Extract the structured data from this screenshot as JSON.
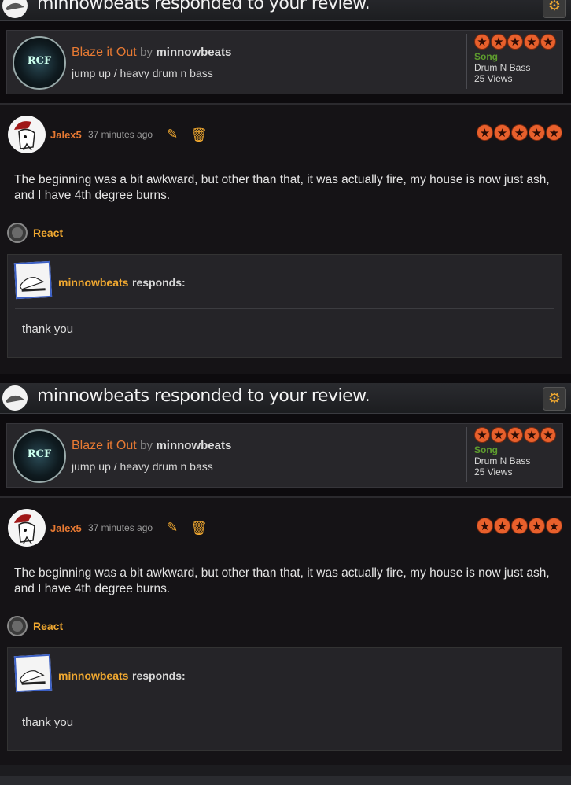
{
  "notifications": [
    {
      "header": {
        "title": "minnowbeats responded to your review.",
        "settings_icon": "gear-icon"
      },
      "song": {
        "art_text": "RCF",
        "title": "Blaze it Out",
        "by": "by",
        "author": "minnowbeats",
        "description": "jump up / heavy drum n bass",
        "rating_stars": 5,
        "type": "Song",
        "genre": "Drum N Bass",
        "views": "25 Views"
      },
      "review": {
        "user": "Jalex5",
        "time": "37 minutes ago",
        "rating_stars": 5,
        "text": "The beginning was a bit awkward, but other than that, it was actually fire, my house is now just ash, and I have 4th degree burns.",
        "react_label": "React"
      },
      "response": {
        "author": "minnowbeats",
        "suffix": "responds:",
        "text": "thank you"
      }
    },
    {
      "header": {
        "title": "minnowbeats responded to your review.",
        "settings_icon": "gear-icon"
      },
      "song": {
        "art_text": "RCF",
        "title": "Blaze it Out",
        "by": "by",
        "author": "minnowbeats",
        "description": "jump up / heavy drum n bass",
        "rating_stars": 5,
        "type": "Song",
        "genre": "Drum N Bass",
        "views": "25 Views"
      },
      "review": {
        "user": "Jalex5",
        "time": "37 minutes ago",
        "rating_stars": 5,
        "text": "The beginning was a bit awkward, but other than that, it was actually fire, my house is now just ash, and I have 4th degree burns.",
        "react_label": "React"
      },
      "response": {
        "author": "minnowbeats",
        "suffix": "responds:",
        "text": "thank you"
      }
    }
  ],
  "colors": {
    "accent_orange": "#e87a33",
    "link_gold": "#f0a830",
    "song_type_green": "#5e9d2e",
    "star": "#e8602c"
  }
}
